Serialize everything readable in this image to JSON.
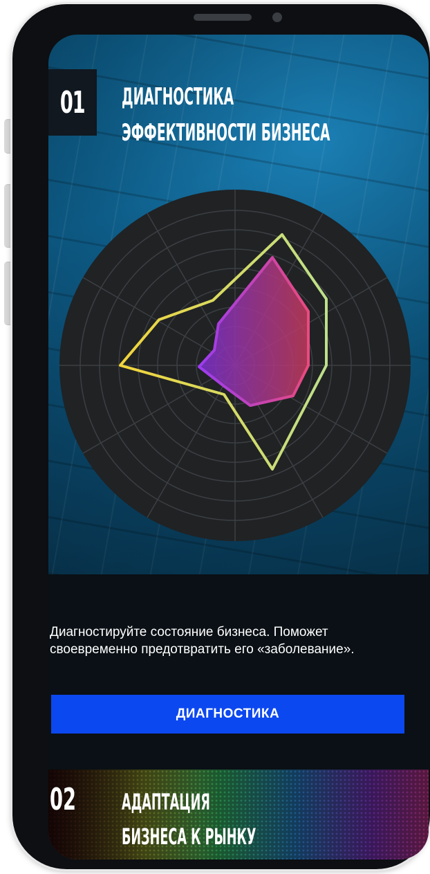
{
  "hero": {
    "number": "01",
    "title_line1": "ДИАГНОСТИКА",
    "title_line2": "ЭФФЕКТИВНОСТИ БИЗНЕСА"
  },
  "description": "Диагностируйте состояние бизнеса. Поможет своевременно предотвратить его «заболевание».",
  "cta_label": "ДИАГНОСТИКА",
  "section2": {
    "number": "02",
    "title_line1": "АДАПТАЦИЯ",
    "title_line2": "БИЗНЕСА К РЫНКУ"
  },
  "colors": {
    "cta": "#0c48f0",
    "radar_bg": "#202224",
    "outer_polygon_gradient": [
      "#f2d43a",
      "#bde08a"
    ],
    "inner_polygon_gradient": [
      "#9b3cf0",
      "#e94a80"
    ]
  }
}
